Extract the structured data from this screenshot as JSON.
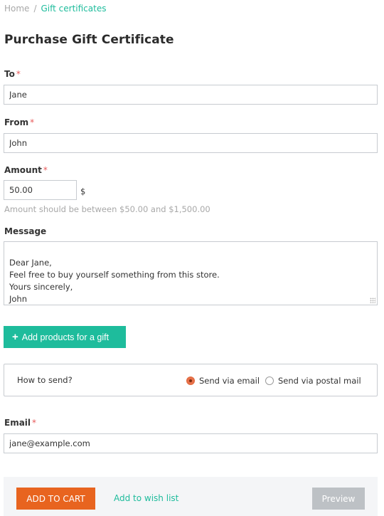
{
  "breadcrumb": {
    "home": "Home",
    "separator": "/",
    "current": "Gift certificates"
  },
  "page": {
    "title": "Purchase Gift Certificate"
  },
  "form": {
    "required_mark": "*",
    "to": {
      "label": "To",
      "value": "Jane"
    },
    "from": {
      "label": "From",
      "value": "John"
    },
    "amount": {
      "label": "Amount",
      "value": "50.00",
      "currency": "$",
      "hint": "Amount should be between $50.00 and $1,500.00"
    },
    "message": {
      "label": "Message",
      "value": "Dear Jane,\nFeel free to buy yourself something from this store.\nYours sincerely,\nJohn"
    },
    "add_products": {
      "icon": "plus-icon",
      "label": "Add products for a gift"
    },
    "send": {
      "question": "How to send?",
      "options": [
        {
          "label": "Send via email",
          "checked": true
        },
        {
          "label": "Send via postal mail",
          "checked": false
        }
      ]
    },
    "email": {
      "label": "Email",
      "value": "jane@example.com"
    }
  },
  "actions": {
    "add_to_cart": "ADD TO CART",
    "wish_list": "Add to wish list",
    "preview": "Preview"
  },
  "colors": {
    "accent": "#1ebc9c",
    "primary_button": "#e8641f",
    "disabled_button": "#bdc1c5",
    "required": "#e85a5a"
  }
}
